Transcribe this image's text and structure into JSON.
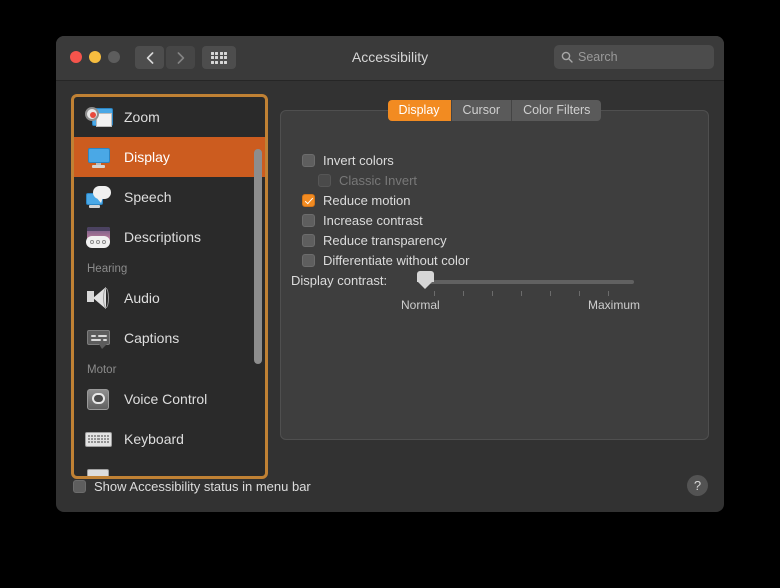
{
  "window": {
    "title": "Accessibility",
    "traffic": {
      "close": "close-button",
      "minimize": "minimize-button",
      "maximize": "maximize-button"
    },
    "nav": {
      "back": "back-button",
      "forward": "forward-button",
      "grid": "show-all-button"
    }
  },
  "search": {
    "value": "",
    "placeholder": "Search"
  },
  "sidebar": {
    "items": [
      {
        "type": "item",
        "label": "Zoom",
        "icon": "zoom-icon",
        "selected": false
      },
      {
        "type": "item",
        "label": "Display",
        "icon": "display-icon",
        "selected": true
      },
      {
        "type": "item",
        "label": "Speech",
        "icon": "speech-icon",
        "selected": false
      },
      {
        "type": "item",
        "label": "Descriptions",
        "icon": "descriptions-icon",
        "selected": false
      },
      {
        "type": "group",
        "label": "Hearing"
      },
      {
        "type": "item",
        "label": "Audio",
        "icon": "audio-icon",
        "selected": false
      },
      {
        "type": "item",
        "label": "Captions",
        "icon": "captions-icon",
        "selected": false
      },
      {
        "type": "group",
        "label": "Motor"
      },
      {
        "type": "item",
        "label": "Voice Control",
        "icon": "voice-control-icon",
        "selected": false
      },
      {
        "type": "item",
        "label": "Keyboard",
        "icon": "keyboard-icon",
        "selected": false
      }
    ]
  },
  "main": {
    "tabs": [
      {
        "label": "Display",
        "active": true
      },
      {
        "label": "Cursor",
        "active": false
      },
      {
        "label": "Color Filters",
        "active": false
      }
    ],
    "checkboxes": [
      {
        "label": "Invert colors",
        "checked": false,
        "disabled": false,
        "indent": false
      },
      {
        "label": "Classic Invert",
        "checked": false,
        "disabled": true,
        "indent": true
      },
      {
        "label": "Reduce motion",
        "checked": true,
        "disabled": false,
        "indent": false
      },
      {
        "label": "Increase contrast",
        "checked": false,
        "disabled": false,
        "indent": false
      },
      {
        "label": "Reduce transparency",
        "checked": false,
        "disabled": false,
        "indent": false
      },
      {
        "label": "Differentiate without color",
        "checked": false,
        "disabled": false,
        "indent": false
      }
    ],
    "slider": {
      "label": "Display contrast:",
      "min_label": "Normal",
      "max_label": "Maximum",
      "value": 0,
      "min": 0,
      "max": 100,
      "tick_count": 7
    }
  },
  "footer": {
    "menubar_checkbox": {
      "label": "Show Accessibility status in menu bar",
      "checked": false
    },
    "help_label": "?"
  },
  "colors": {
    "accent_orange": "#f28b21",
    "selection_orange": "#cc5c1f",
    "focus_ring": "#c08134",
    "window_bg": "#323232",
    "panel_bg": "#3e3e3e",
    "sidebar_bg": "#2a2a2a"
  }
}
